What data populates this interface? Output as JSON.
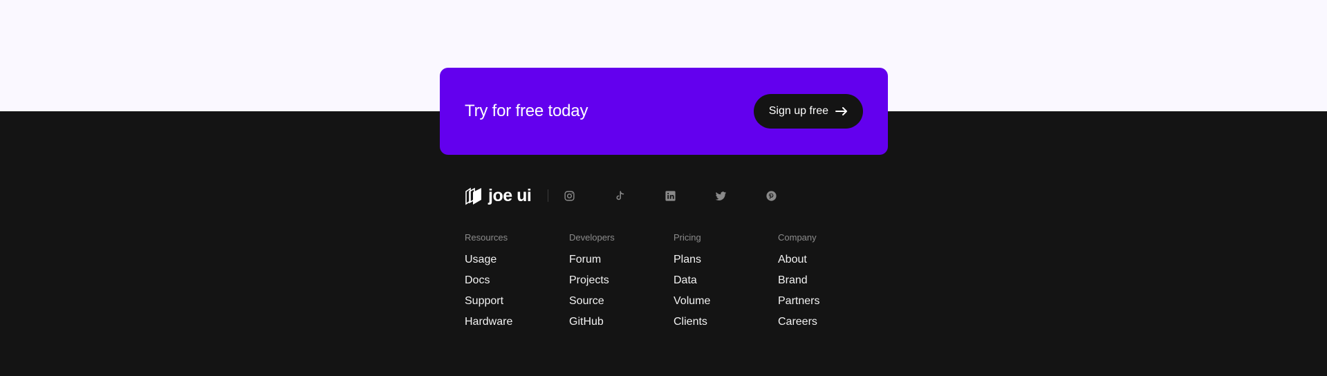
{
  "cta": {
    "title": "Try for free today",
    "button_label": "Sign up free",
    "accent": "#6300ee"
  },
  "brand": {
    "name": "joe ui"
  },
  "socials": [
    "instagram-icon",
    "tiktok-icon",
    "linkedin-icon",
    "twitter-icon",
    "pinterest-icon"
  ],
  "columns": [
    {
      "title": "Resources",
      "links": [
        "Usage",
        "Docs",
        "Support",
        "Hardware"
      ]
    },
    {
      "title": "Developers",
      "links": [
        "Forum",
        "Projects",
        "Source",
        "GitHub"
      ]
    },
    {
      "title": "Pricing",
      "links": [
        "Plans",
        "Data",
        "Volume",
        "Clients"
      ]
    },
    {
      "title": "Company",
      "links": [
        "About",
        "Brand",
        "Partners",
        "Careers"
      ]
    }
  ]
}
